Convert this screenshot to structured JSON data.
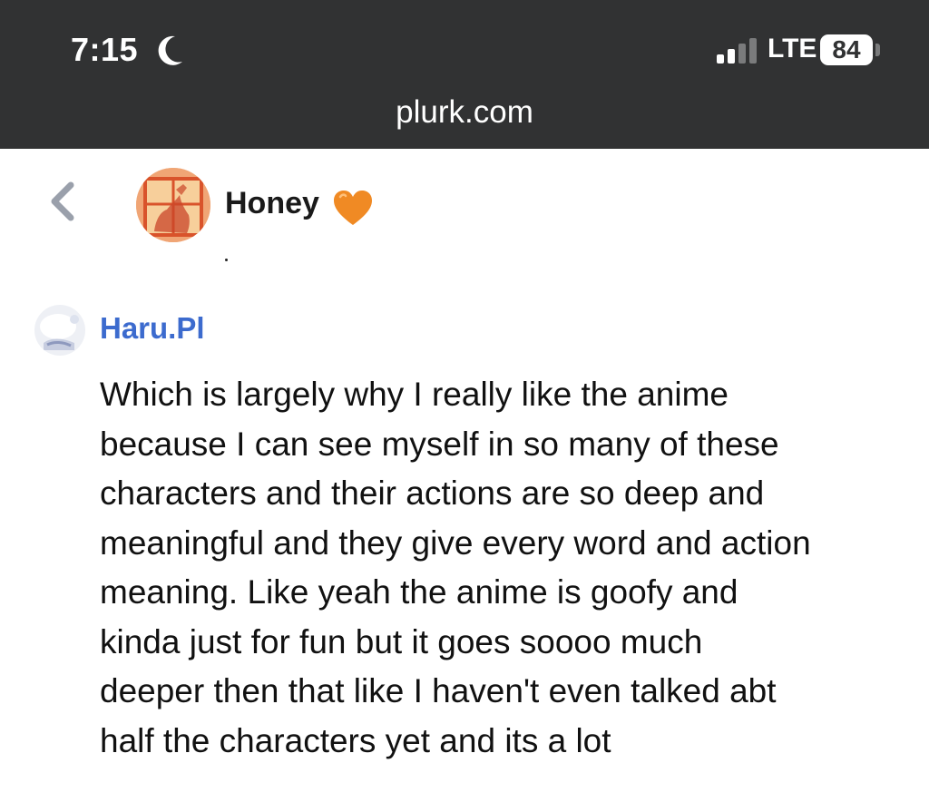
{
  "status_bar": {
    "time": "7:15",
    "focus_icon": "moon-icon",
    "signal_icon": "cellular-signal-icon",
    "network": "LTE",
    "battery": "84"
  },
  "browser": {
    "url": "plurk.com"
  },
  "plurk": {
    "back_icon": "chevron-left-icon",
    "owner_name": "Honey",
    "owner_emoji": "orange-heart-icon",
    "owner_status": "."
  },
  "response": {
    "author": "Haru.Pl",
    "lines": [
      "Which is largely why I really like the anime",
      "because I can see myself in so many of these",
      "characters and their actions are so deep and",
      "meaningful and they give every word and action",
      "meaning. Like yeah the anime is goofy and",
      "kinda just for fun but it goes soooo much",
      "deeper then that like I haven't even talked abt",
      "half the characters yet and its a lot"
    ]
  },
  "colors": {
    "chrome_bg": "#313233",
    "link_blue": "#3c6bce",
    "heart_orange": "#f08a24"
  }
}
